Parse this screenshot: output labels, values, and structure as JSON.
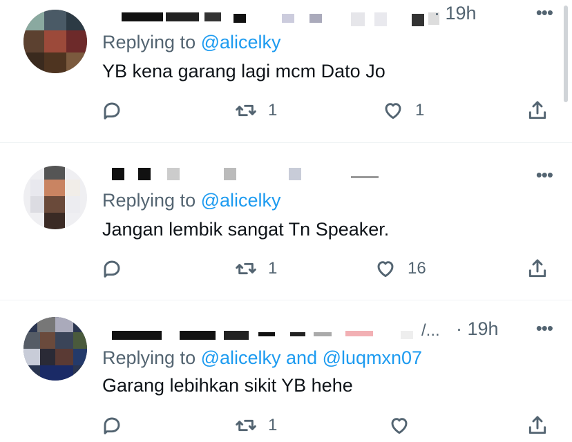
{
  "tweets": [
    {
      "time": "· 19h",
      "reply_prefix": "Replying to ",
      "reply_handles": [
        "@alicelky"
      ],
      "reply_joiner": "",
      "text": "YB kena garang lagi mcm Dato Jo",
      "reply_count": "",
      "retweet_count": "1",
      "like_count": "1"
    },
    {
      "time": "",
      "reply_prefix": "Replying to ",
      "reply_handles": [
        "@alicelky"
      ],
      "reply_joiner": "",
      "text": "Jangan lembik sangat Tn Speaker.",
      "reply_count": "",
      "retweet_count": "1",
      "like_count": "16"
    },
    {
      "time": "· 19h",
      "reply_prefix": "Replying to ",
      "reply_handles": [
        "@alicelky",
        "@luqmxn07"
      ],
      "reply_joiner": " and ",
      "text": "Garang lebihkan sikit YB hehe",
      "reply_count": "",
      "retweet_count": "1",
      "like_count": ""
    }
  ],
  "more_label": "•••",
  "truncation": "/...",
  "icons": {
    "reply": "reply-icon",
    "retweet": "retweet-icon",
    "like": "heart-icon",
    "share": "share-icon",
    "more": "more-icon"
  },
  "colors": {
    "link": "#1d9bf0",
    "secondary": "#536471",
    "text": "#0f1419",
    "divider": "#eff3f4"
  }
}
